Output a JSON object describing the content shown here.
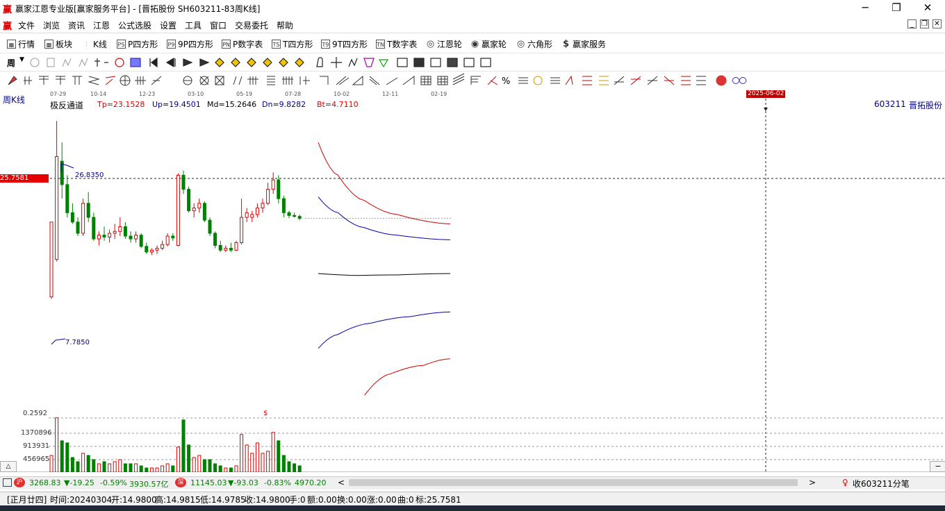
{
  "window": {
    "title": "赢家江恩专业版[赢家服务平台] - [晋拓股份  SH603211-83周K线]",
    "app_icon": "赢",
    "minimize": "─",
    "restore": "❐",
    "close": "✕"
  },
  "menu": {
    "icon": "赢",
    "items": [
      "文件",
      "浏览",
      "资讯",
      "江恩",
      "公式选股",
      "设置",
      "工具",
      "窗口",
      "交易委托",
      "帮助"
    ],
    "mdi": [
      "_",
      "❐",
      "✕"
    ]
  },
  "toolbar1": {
    "items": [
      {
        "icon": "▦",
        "label": "行情"
      },
      {
        "icon": "▩",
        "label": "板块"
      },
      {
        "icon": "⫶",
        "label": "K线"
      },
      {
        "icon": "PS",
        "label": "P四方形"
      },
      {
        "icon": "P9",
        "label": "9P四方形"
      },
      {
        "icon": "PN",
        "label": "P数字表"
      },
      {
        "icon": "TS",
        "label": "T四方形"
      },
      {
        "icon": "T9",
        "label": "9T四方形"
      },
      {
        "icon": "TN",
        "label": "T数字表"
      },
      {
        "icon": "◎",
        "label": "江恩轮"
      },
      {
        "icon": "◉",
        "label": "赢家轮"
      },
      {
        "icon": "◎",
        "label": "六角形"
      },
      {
        "icon": "$",
        "label": "赢家服务"
      }
    ]
  },
  "toolbar2": {
    "period_label": "周"
  },
  "chart": {
    "period_label": "周K线",
    "date_ticks": [
      "07-29",
      "10-14",
      "12-23",
      "03-10",
      "05-19",
      "07-28",
      "10-02",
      "12-11",
      "02-19"
    ],
    "cursor_date": "2025-06-02",
    "cursor_price": "25.7581",
    "indicator_name": "极反通道",
    "tp": "Tp=23.1528",
    "up": "Up=19.4501",
    "md": "Md=15.2646",
    "dn": "Dn=9.8282",
    "bt": "Bt=4.7110",
    "stock_code": "603211",
    "stock_name": "晋拓股份",
    "high_label": "26.8350",
    "low_label": "7.7850",
    "vol_ticks": [
      "0.2592",
      "1370896",
      "913931",
      "456965"
    ],
    "vol_marker": "$",
    "colors": {
      "up": "#e00000",
      "down": "#008000",
      "tp_bt": "#d00000",
      "up_dn": "#0000b0",
      "md": "#000000"
    }
  },
  "chart_data": {
    "type": "candlestick",
    "candles": [
      {
        "o": 8.0,
        "h": 16.0,
        "l": 7.8,
        "c": 16.0
      },
      {
        "o": 12.0,
        "h": 26.8,
        "l": 11.8,
        "c": 23.0
      },
      {
        "o": 22.5,
        "h": 24.5,
        "l": 18.5,
        "c": 20.0
      },
      {
        "o": 20.0,
        "h": 21.0,
        "l": 16.5,
        "c": 17.0
      },
      {
        "o": 17.0,
        "h": 18.0,
        "l": 15.8,
        "c": 16.0
      },
      {
        "o": 16.0,
        "h": 16.5,
        "l": 14.5,
        "c": 14.8
      },
      {
        "o": 14.8,
        "h": 18.5,
        "l": 14.5,
        "c": 18.0
      },
      {
        "o": 18.0,
        "h": 19.2,
        "l": 16.0,
        "c": 16.5
      },
      {
        "o": 16.5,
        "h": 17.0,
        "l": 14.0,
        "c": 14.2
      },
      {
        "o": 14.2,
        "h": 15.0,
        "l": 13.5,
        "c": 14.6
      },
      {
        "o": 14.6,
        "h": 15.5,
        "l": 14.0,
        "c": 14.4
      },
      {
        "o": 14.4,
        "h": 15.2,
        "l": 13.8,
        "c": 14.8
      },
      {
        "o": 14.8,
        "h": 15.8,
        "l": 14.2,
        "c": 15.0
      },
      {
        "o": 15.0,
        "h": 16.5,
        "l": 14.5,
        "c": 15.5
      },
      {
        "o": 15.5,
        "h": 16.0,
        "l": 14.2,
        "c": 14.5
      },
      {
        "o": 14.5,
        "h": 15.0,
        "l": 13.8,
        "c": 14.2
      },
      {
        "o": 14.2,
        "h": 15.0,
        "l": 13.8,
        "c": 14.6
      },
      {
        "o": 14.6,
        "h": 14.8,
        "l": 13.2,
        "c": 13.4
      },
      {
        "o": 13.4,
        "h": 13.8,
        "l": 12.6,
        "c": 12.8
      },
      {
        "o": 12.8,
        "h": 13.2,
        "l": 12.5,
        "c": 13.0
      },
      {
        "o": 13.0,
        "h": 13.5,
        "l": 12.6,
        "c": 13.2
      },
      {
        "o": 13.2,
        "h": 14.0,
        "l": 13.0,
        "c": 13.6
      },
      {
        "o": 13.6,
        "h": 14.8,
        "l": 13.4,
        "c": 14.5
      },
      {
        "o": 14.5,
        "h": 14.8,
        "l": 14.0,
        "c": 14.3
      },
      {
        "o": 13.5,
        "h": 21.2,
        "l": 13.4,
        "c": 21.0
      },
      {
        "o": 21.0,
        "h": 21.5,
        "l": 19.0,
        "c": 19.5
      },
      {
        "o": 19.5,
        "h": 19.8,
        "l": 17.0,
        "c": 17.2
      },
      {
        "o": 17.2,
        "h": 18.0,
        "l": 16.5,
        "c": 17.5
      },
      {
        "o": 17.5,
        "h": 18.5,
        "l": 17.0,
        "c": 18.0
      },
      {
        "o": 18.0,
        "h": 18.2,
        "l": 16.0,
        "c": 16.2
      },
      {
        "o": 16.2,
        "h": 16.5,
        "l": 14.5,
        "c": 14.8
      },
      {
        "o": 14.8,
        "h": 15.0,
        "l": 13.2,
        "c": 13.5
      },
      {
        "o": 13.5,
        "h": 14.0,
        "l": 12.8,
        "c": 13.0
      },
      {
        "o": 13.0,
        "h": 13.5,
        "l": 12.8,
        "c": 13.2
      },
      {
        "o": 13.2,
        "h": 13.8,
        "l": 12.8,
        "c": 13.0
      },
      {
        "o": 13.0,
        "h": 14.0,
        "l": 12.9,
        "c": 13.8
      },
      {
        "o": 13.8,
        "h": 18.5,
        "l": 13.6,
        "c": 16.5
      },
      {
        "o": 16.5,
        "h": 17.5,
        "l": 16.0,
        "c": 17.0
      },
      {
        "o": 16.5,
        "h": 17.2,
        "l": 16.0,
        "c": 16.8
      },
      {
        "o": 16.8,
        "h": 18.0,
        "l": 16.5,
        "c": 17.5
      },
      {
        "o": 17.5,
        "h": 18.5,
        "l": 17.0,
        "c": 18.0
      },
      {
        "o": 18.0,
        "h": 20.2,
        "l": 17.8,
        "c": 19.5
      },
      {
        "o": 19.5,
        "h": 21.3,
        "l": 19.0,
        "c": 20.5
      },
      {
        "o": 20.5,
        "h": 21.0,
        "l": 18.0,
        "c": 18.5
      },
      {
        "o": 18.5,
        "h": 18.8,
        "l": 16.5,
        "c": 17.0
      },
      {
        "o": 17.0,
        "h": 17.2,
        "l": 16.4,
        "c": 16.7
      },
      {
        "o": 16.7,
        "h": 17.0,
        "l": 16.5,
        "c": 16.6
      },
      {
        "o": 16.6,
        "h": 16.8,
        "l": 16.2,
        "c": 16.4
      }
    ],
    "volumes": [
      0.08,
      0.26,
      0.15,
      0.14,
      0.07,
      0.05,
      0.09,
      0.08,
      0.06,
      0.04,
      0.05,
      0.04,
      0.05,
      0.06,
      0.04,
      0.04,
      0.04,
      0.03,
      0.02,
      0.02,
      0.02,
      0.03,
      0.04,
      0.03,
      0.12,
      0.25,
      0.13,
      0.07,
      0.08,
      0.06,
      0.06,
      0.04,
      0.03,
      0.02,
      0.02,
      0.03,
      0.18,
      0.13,
      0.09,
      0.14,
      0.09,
      0.1,
      0.19,
      0.15,
      0.08,
      0.05,
      0.04,
      0.03
    ],
    "channel": {
      "tp": [
        [
          0,
          24.5
        ],
        [
          0.15,
          21.0
        ],
        [
          0.35,
          18.3
        ],
        [
          0.6,
          16.8
        ],
        [
          1,
          15.8
        ]
      ],
      "up": [
        [
          0,
          18.7
        ],
        [
          0.15,
          17.0
        ],
        [
          0.35,
          15.4
        ],
        [
          0.6,
          14.6
        ],
        [
          1,
          14.1
        ]
      ],
      "md": [
        [
          0,
          10.5
        ],
        [
          0.3,
          10.3
        ],
        [
          0.6,
          10.35
        ],
        [
          1,
          10.5
        ]
      ],
      "dn": [
        [
          0,
          2.5
        ],
        [
          0.15,
          4.0
        ],
        [
          0.4,
          5.2
        ],
        [
          0.7,
          5.9
        ],
        [
          1,
          6.4
        ]
      ],
      "bt": [
        [
          0.35,
          -2.5
        ],
        [
          0.55,
          -0.2
        ],
        [
          0.8,
          0.7
        ],
        [
          1,
          1.4
        ]
      ]
    },
    "ylim": [
      -3,
      28
    ],
    "vol_max": 0.2592
  },
  "hscroll": {
    "sh_index": "3268.83",
    "sh_change": "▼-19.25",
    "sh_pct": "-0.59%",
    "sh_amount": "3930.57亿",
    "sz_index": "11145.03",
    "sz_change": "▼-93.03",
    "sz_pct": "-0.83%",
    "sz_amount": "4970.20",
    "right_label": "收603211分笔"
  },
  "status": {
    "lunar": "[正月廿四]",
    "time": "时间:20240304",
    "open": "开:14.9800",
    "high": "高:14.9815",
    "low": "低:14.9785",
    "close": "收:14.9800",
    "hand": "手:0",
    "amount": "额:0.00",
    "turnover": "换:0.00",
    "change": "涨:0.00",
    "min": "曲:0",
    "mark": "标:25.7581"
  }
}
